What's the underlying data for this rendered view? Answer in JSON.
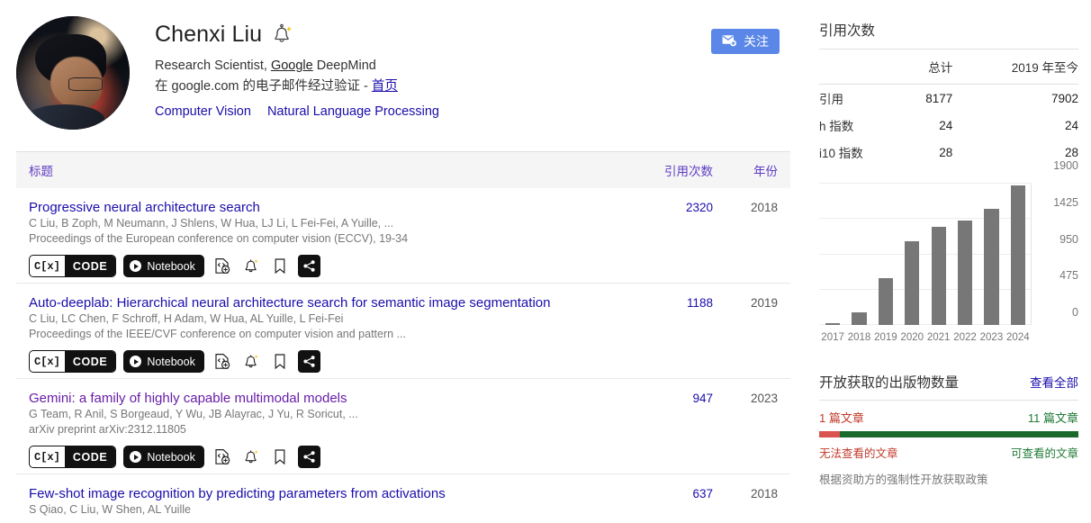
{
  "profile": {
    "name": "Chenxi Liu",
    "bell_icon": "bell-sparkle-icon",
    "affiliation_prefix": "Research Scientist, ",
    "affiliation_link": "Google",
    "affiliation_suffix": " DeepMind",
    "verified_text": "在 google.com 的电子邮件经过验证 - ",
    "homepage_link": "首页",
    "interests": [
      "Computer Vision",
      "Natural Language Processing"
    ],
    "follow_label": "关注",
    "follow_icon": "envelope-plus-icon",
    "follow_color": "#5b87e8"
  },
  "publications": {
    "columns": {
      "title": "标题",
      "citations": "引用次数",
      "year": "年份"
    },
    "action_labels": {
      "code": "CODE",
      "code_mark": "C[x]",
      "notebook": "Notebook"
    },
    "action_icons": [
      "code-add-icon",
      "bell-sparkle-icon",
      "bookmark-icon",
      "share-icon"
    ],
    "rows": [
      {
        "title": "Progressive neural architecture search",
        "visited": false,
        "authors": "C Liu, B Zoph, M Neumann, J Shlens, W Hua, LJ Li, L Fei-Fei, A Yuille, ...",
        "venue": "Proceedings of the European conference on computer vision (ECCV), 19-34",
        "citations": "2320",
        "year": "2018",
        "has_actions": true
      },
      {
        "title": "Auto-deeplab: Hierarchical neural architecture search for semantic image segmentation",
        "visited": false,
        "authors": "C Liu, LC Chen, F Schroff, H Adam, W Hua, AL Yuille, L Fei-Fei",
        "venue": "Proceedings of the IEEE/CVF conference on computer vision and pattern ...",
        "citations": "1188",
        "year": "2019",
        "has_actions": true
      },
      {
        "title": "Gemini: a family of highly capable multimodal models",
        "visited": true,
        "authors": "G Team, R Anil, S Borgeaud, Y Wu, JB Alayrac, J Yu, R Soricut, ...",
        "venue": "arXiv preprint arXiv:2312.11805",
        "citations": "947",
        "year": "2023",
        "has_actions": true
      },
      {
        "title": "Few-shot image recognition by predicting parameters from activations",
        "visited": false,
        "authors": "S Qiao, C Liu, W Shen, AL Yuille",
        "venue": "",
        "citations": "637",
        "year": "2018",
        "has_actions": false
      }
    ]
  },
  "sidebar": {
    "citations_title": "引用次数",
    "stats_header": {
      "metric": "",
      "total": "总计",
      "since": "2019 年至今"
    },
    "stats_rows": [
      {
        "label": "引用",
        "total": "8177",
        "since": "7902"
      },
      {
        "label": "h 指数",
        "total": "24",
        "since": "24"
      },
      {
        "label": "i10 指数",
        "total": "28",
        "since": "28"
      }
    ],
    "open_access": {
      "title": "开放获取的出版物数量",
      "view_all": "查看全部",
      "unavailable_count": "1 篇文章",
      "available_count": "11 篇文章",
      "unavailable_label": "无法查看的文章",
      "available_label": "可查看的文章",
      "note": "根据资助方的强制性开放获取政策",
      "unavailable_color": "#c0392b",
      "available_color": "#1d7a34",
      "unavailable_pct": 8,
      "available_pct": 92
    }
  },
  "chart_data": {
    "type": "bar",
    "title": "",
    "categories": [
      "2017",
      "2018",
      "2019",
      "2020",
      "2021",
      "2022",
      "2023",
      "2024"
    ],
    "values": [
      30,
      175,
      625,
      1120,
      1320,
      1400,
      1560,
      1880
    ],
    "ylim": [
      0,
      1900
    ],
    "yticks": [
      0,
      475,
      950,
      1425,
      1900
    ],
    "ytick_labels": [
      "0",
      "475",
      "950",
      "1425",
      "1900"
    ],
    "xlabel": "",
    "ylabel": "",
    "grid": true,
    "bar_color": "#777777",
    "legend": "none"
  }
}
